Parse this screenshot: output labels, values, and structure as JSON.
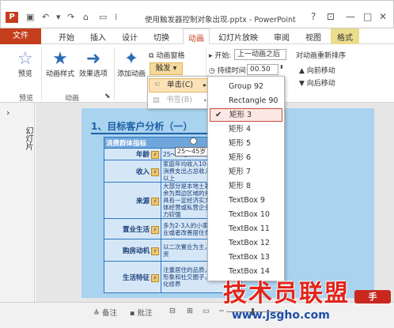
{
  "window": {
    "app_icon": "P",
    "title": "使用触发器控制对象出现.pptx - PowerPoint",
    "help": "?",
    "restore_icon": "ribbon-display-icon",
    "minimize": "—",
    "maximize": "□",
    "close": "✕"
  },
  "quick_access": [
    "save-icon",
    "undo-icon",
    "redo-icon",
    "present-icon",
    "customize-icon"
  ],
  "tabs": [
    {
      "label": "文件",
      "state": "file"
    },
    {
      "label": "开始"
    },
    {
      "label": "插入"
    },
    {
      "label": "设计"
    },
    {
      "label": "切换"
    },
    {
      "label": "动画",
      "state": "active"
    },
    {
      "label": "幻灯片放映"
    },
    {
      "label": "审阅"
    },
    {
      "label": "视图"
    },
    {
      "label": "格式",
      "state": "contextual"
    }
  ],
  "ribbon": {
    "preview": {
      "button": "预览",
      "group": "预览"
    },
    "animation": {
      "styles": "动画样式",
      "effect_options": "效果选项",
      "group": "动画"
    },
    "advanced": {
      "add_animation": "添加动画",
      "animation_pane": "动画窗格",
      "trigger": "触发",
      "trigger_arrow": "▾"
    },
    "timing": {
      "start_label": "开始:",
      "start_value": "上一动画之后",
      "duration_label": "持续时间:",
      "duration_value": "00.50",
      "reorder_title": "对动画重新排序",
      "move_earlier": "向前移动",
      "move_later": "向后移动"
    }
  },
  "left_pane": {
    "label": "幻灯片",
    "number": "1"
  },
  "slide": {
    "title": "1、目标客户分析（一）",
    "table": [
      {
        "label": "消费群体指标",
        "value": "",
        "header": true
      },
      {
        "label": "年龄",
        "value": "25～45岁"
      },
      {
        "label": "收入",
        "value": "家庭年均收入10-20万，年均消费支出占总收入40%-60%以上"
      },
      {
        "label": "来源",
        "value": "大部分是本地土著居民，其余为周边区域的外来人口，具有一定经济实力，从事个体经营或私营企业，消费能力较强"
      },
      {
        "label": "置业生活",
        "value": "多为2-3人的小家庭，首次置业或者改善居住条件"
      },
      {
        "label": "购房动机",
        "value": "以二次置业为主，自住兼投资"
      },
      {
        "label": "生活特征",
        "value": "注重居住的品质，关注自身形象和社交圈子，有一定文化修养"
      }
    ],
    "selected_shape_text": "25～45岁"
  },
  "trigger_menu": [
    {
      "label": "单击(C)",
      "highlighted": true
    },
    {
      "label": "书签(B)",
      "disabled": true
    }
  ],
  "submenu_items": [
    {
      "label": "Group 92"
    },
    {
      "label": "Rectangle 90"
    },
    {
      "label": "矩形 3",
      "checked": true
    },
    {
      "label": "矩形 4"
    },
    {
      "label": "矩形 5"
    },
    {
      "label": "矩形 6"
    },
    {
      "label": "矩形 7"
    },
    {
      "label": "矩形 8"
    },
    {
      "label": "TextBox 9"
    },
    {
      "label": "TextBox 10"
    },
    {
      "label": "TextBox 11"
    },
    {
      "label": "TextBox 12"
    },
    {
      "label": "TextBox 13"
    },
    {
      "label": "TextBox 14"
    }
  ],
  "statusbar": {
    "notes": "备注",
    "comments": "批注",
    "zoom_minus": "−",
    "zoom_plus": "+"
  },
  "watermark": {
    "main": "技术员联盟",
    "url": "www.jsgho.com",
    "badge": "手"
  },
  "colors": {
    "accent": "#c43e1c",
    "trigger_highlight": "#f6d99c",
    "slide_bg": "#a9d3ee",
    "selection_border": "#c84a3a"
  }
}
